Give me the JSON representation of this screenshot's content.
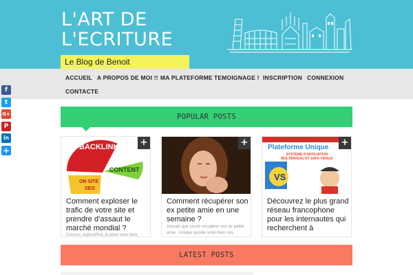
{
  "header": {
    "title_line1": "L'ART DE",
    "title_line2": "L'ECRITURE",
    "tagline": "Le Blog de Benoit"
  },
  "nav": {
    "items": [
      "ACCUEIL",
      "A PROPOS DE MOI !!",
      "MA PLATEFORME",
      "TEMOIGNAGE !",
      "INSCRIPTION",
      "CONNEXION",
      "CONTACTE"
    ]
  },
  "social": {
    "buttons": [
      {
        "icon": "facebook-icon",
        "glyph": "f",
        "color": "#3b5998"
      },
      {
        "icon": "twitter-icon",
        "glyph": "t",
        "color": "#1da1f2"
      },
      {
        "icon": "google-plus-icon",
        "glyph": "G+",
        "color": "#dd4b39"
      },
      {
        "icon": "pinterest-icon",
        "glyph": "P",
        "color": "#cb2027"
      },
      {
        "icon": "linkedin-icon",
        "glyph": "in",
        "color": "#0077b5"
      },
      {
        "icon": "share-icon",
        "glyph": "+",
        "color": "#1e90ff"
      }
    ]
  },
  "popular": {
    "heading": "POPULAR POSTS",
    "posts": [
      {
        "title": "Comment exploser le trafic de votre site et prendre d’assaut le marché mondial ?",
        "excerpt": "Coucou, aujourd'hui, je peux vous faire",
        "thumb_words": [
          "BACKLINKS",
          "CONTENT",
          "ON SITE",
          "SEO"
        ]
      },
      {
        "title": "Comment récupérer son ex petite amie en une semaine ?",
        "excerpt": "Avouez que savoir récupérer son ex petite amie , lorsque qu'elle reste dans vos",
        "thumb_words": []
      },
      {
        "title": "Découvrez le plus grand réseau francophone pour les internautes qui recherchent à",
        "excerpt": "",
        "thumb_words": [
          "Plateforme Unique",
          "SYSTEME D'AFFILIATION MULTINIVEAU ET 100% VIRALE",
          "VS"
        ]
      }
    ]
  },
  "latest": {
    "heading": "LATEST POSTS"
  },
  "colors": {
    "header_bg": "#4cbfd4",
    "tagline_bg": "#f5f35a",
    "popular_bar": "#34cf74",
    "latest_bar": "#f97a62",
    "nav_bg": "#e7e7e7"
  }
}
